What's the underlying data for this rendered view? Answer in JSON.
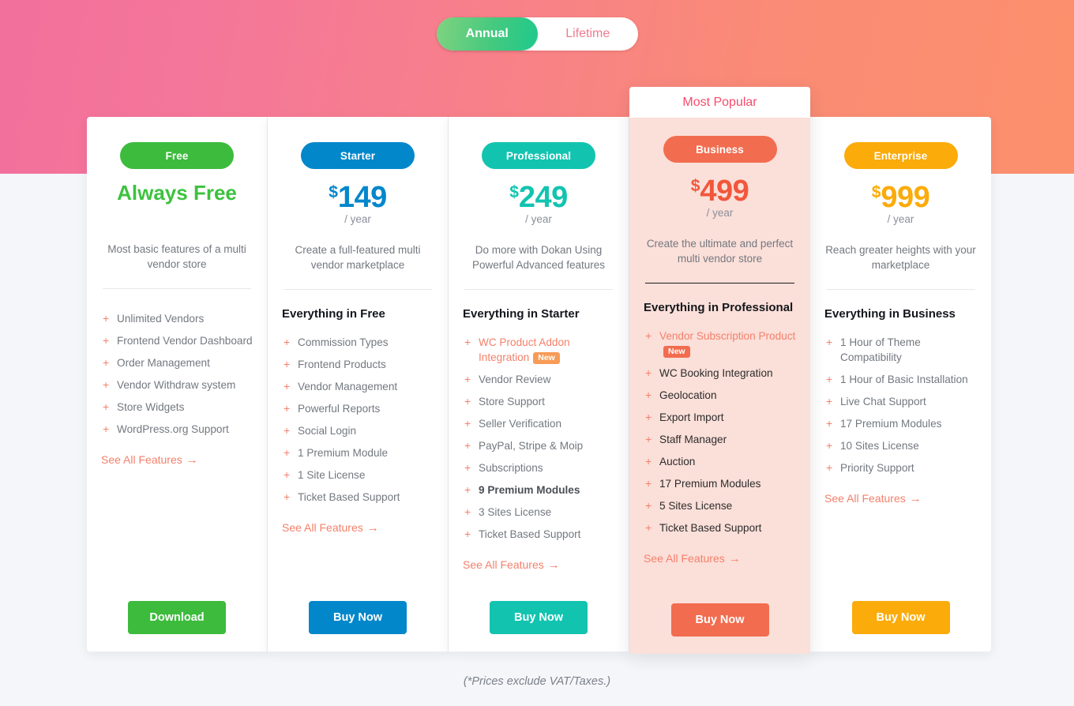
{
  "billing_toggle": {
    "options": [
      {
        "label": "Annual",
        "active": true
      },
      {
        "label": "Lifetime",
        "active": false
      }
    ]
  },
  "footnote": "(*Prices exclude VAT/Taxes.)",
  "colors": {
    "gradient_start": "#f2709c",
    "gradient_end": "#fc906c",
    "page_bg": "#f4f6f9",
    "accent_coral": "#f4806b",
    "popular_label": "#f94a6b",
    "featured_bg": "#fbdfd9"
  },
  "plans": [
    {
      "name": "Free",
      "badge_color": "#3cbb3c",
      "price_color": "#3cc23f",
      "is_free": true,
      "price_text": "Always Free",
      "currency": "$",
      "amount": "",
      "period": "",
      "description": "Most basic features of a multi vendor store",
      "features_heading": "",
      "features": [
        {
          "text": "Unlimited Vendors"
        },
        {
          "text": "Frontend Vendor Dashboard"
        },
        {
          "text": "Order Management"
        },
        {
          "text": "Vendor Withdraw system"
        },
        {
          "text": "Store Widgets"
        },
        {
          "text": "WordPress.org Support"
        }
      ],
      "see_all_label": "See All Features",
      "see_all_arrow": "→",
      "cta_label": "Download",
      "cta_color": "#3cbb3c",
      "featured": false,
      "popular_label": ""
    },
    {
      "name": "Starter",
      "badge_color": "#0287cb",
      "price_color": "#0287cb",
      "is_free": false,
      "price_text": "",
      "currency": "$",
      "amount": "149",
      "period": "/ year",
      "description": "Create a full-featured multi vendor marketplace",
      "features_heading": "Everything in Free",
      "features": [
        {
          "text": "Commission Types"
        },
        {
          "text": "Frontend Products"
        },
        {
          "text": "Vendor Management"
        },
        {
          "text": "Powerful Reports"
        },
        {
          "text": "Social Login"
        },
        {
          "text": "1 Premium Module"
        },
        {
          "text": "1 Site License"
        },
        {
          "text": "Ticket Based Support"
        }
      ],
      "see_all_label": "See All Features",
      "see_all_arrow": "→",
      "cta_label": "Buy Now",
      "cta_color": "#0287cb",
      "featured": false,
      "popular_label": ""
    },
    {
      "name": "Professional",
      "badge_color": "#12c4b0",
      "price_color": "#12c4b0",
      "is_free": false,
      "price_text": "",
      "currency": "$",
      "amount": "249",
      "period": "/ year",
      "description": "Do more with Dokan Using Powerful Advanced features",
      "features_heading": "Everything in Starter",
      "features": [
        {
          "text": "WC Product Addon Integration",
          "highlight": true,
          "badge": "New"
        },
        {
          "text": "Vendor Review"
        },
        {
          "text": "Store Support"
        },
        {
          "text": "Seller Verification"
        },
        {
          "text": "PayPal, Stripe & Moip"
        },
        {
          "text": "Subscriptions"
        },
        {
          "text": "9 Premium Modules",
          "bold": true
        },
        {
          "text": "3 Sites License"
        },
        {
          "text": "Ticket Based Support"
        }
      ],
      "see_all_label": "See All Features",
      "see_all_arrow": "→",
      "cta_label": "Buy Now",
      "cta_color": "#12c4b0",
      "featured": false,
      "popular_label": ""
    },
    {
      "name": "Business",
      "badge_color": "#f26c4f",
      "price_color": "#f2573b",
      "is_free": false,
      "price_text": "",
      "currency": "$",
      "amount": "499",
      "period": "/ year",
      "description": "Create the ultimate and perfect multi vendor store",
      "features_heading": "Everything in Professional",
      "features": [
        {
          "text": "Vendor Subscription Product",
          "highlight": true,
          "badge": "New"
        },
        {
          "text": "WC Booking Integration"
        },
        {
          "text": "Geolocation"
        },
        {
          "text": "Export Import"
        },
        {
          "text": "Staff Manager"
        },
        {
          "text": "Auction"
        },
        {
          "text": "17 Premium Modules"
        },
        {
          "text": "5 Sites License"
        },
        {
          "text": "Ticket Based Support"
        }
      ],
      "see_all_label": "See All Features",
      "see_all_arrow": "→",
      "cta_label": "Buy Now",
      "cta_color": "#f26c4f",
      "featured": true,
      "popular_label": "Most Popular"
    },
    {
      "name": "Enterprise",
      "badge_color": "#fbab0a",
      "price_color": "#fbab0a",
      "is_free": false,
      "price_text": "",
      "currency": "$",
      "amount": "999",
      "period": "/ year",
      "description": "Reach greater heights with your marketplace",
      "features_heading": "Everything in Business",
      "features": [
        {
          "text": "1 Hour of Theme Compatibility"
        },
        {
          "text": "1 Hour of Basic Installation"
        },
        {
          "text": "Live Chat Support"
        },
        {
          "text": "17 Premium Modules"
        },
        {
          "text": "10 Sites License"
        },
        {
          "text": "Priority Support"
        }
      ],
      "see_all_label": "See All Features",
      "see_all_arrow": "→",
      "cta_label": "Buy Now",
      "cta_color": "#fbab0a",
      "featured": false,
      "popular_label": ""
    }
  ]
}
